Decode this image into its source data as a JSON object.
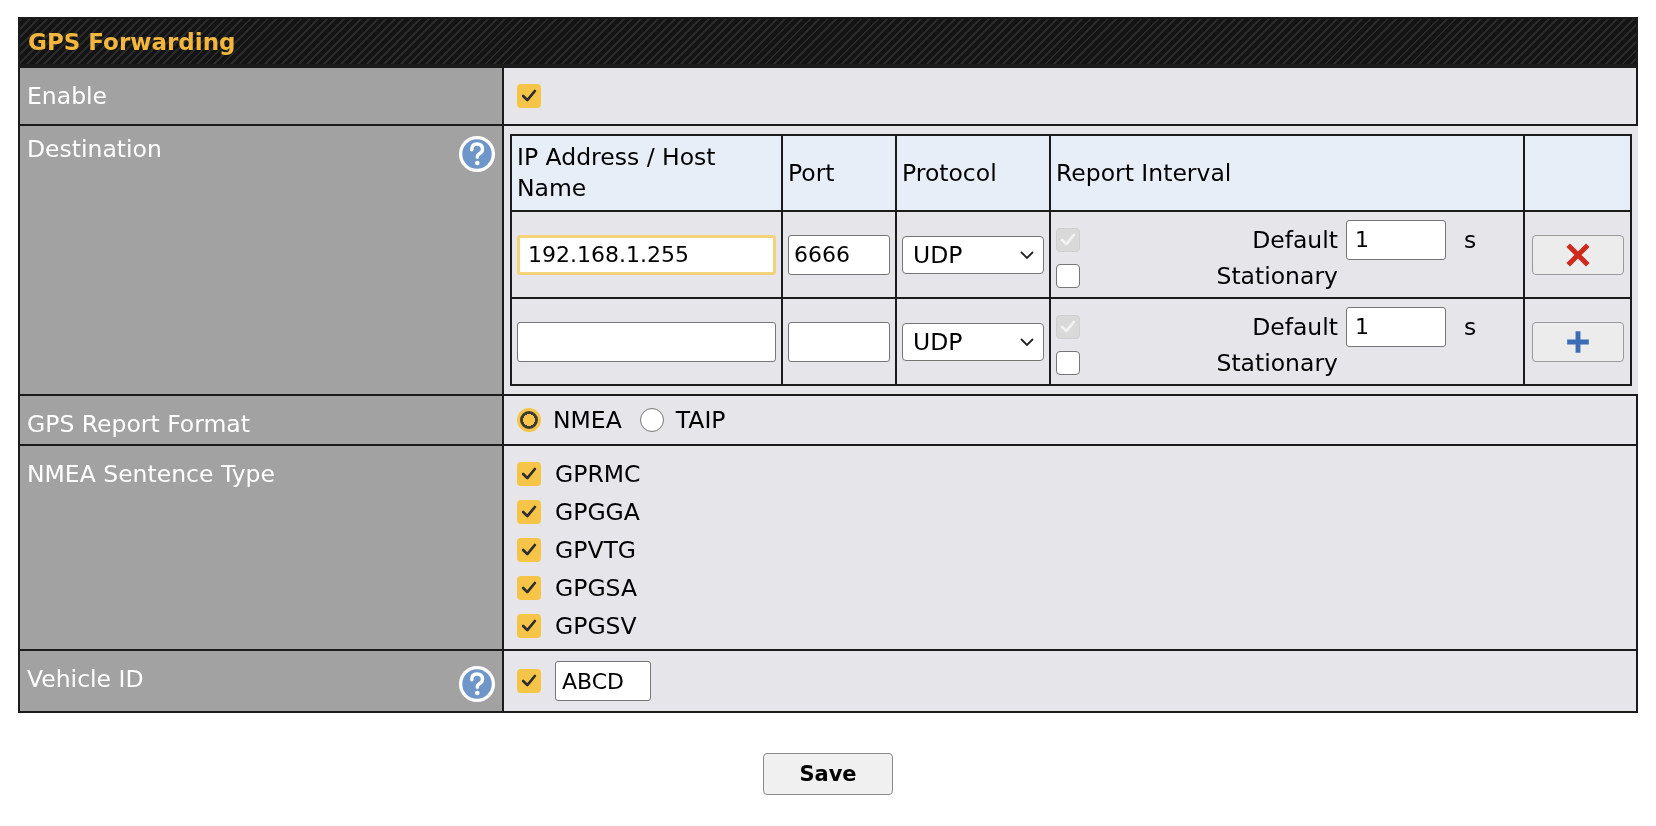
{
  "section": {
    "title": "GPS Forwarding"
  },
  "rows": [
    {
      "kind": "checkbox",
      "label": "Enable",
      "help": false,
      "checked": true
    },
    {
      "kind": "destinations",
      "label": "Destination",
      "help": true,
      "columns": [
        "IP Address / Host Name",
        "Port",
        "Protocol",
        "Report Interval"
      ],
      "entries": [
        {
          "host": "192.168.1.255",
          "host_focused": true,
          "port": "6666",
          "protocol": "UDP",
          "default_checked": true,
          "default_disabled": true,
          "default_label": "Default",
          "interval": "1",
          "unit": "s",
          "stationary_checked": false,
          "stationary_label": "Stationary",
          "kind": "remove"
        },
        {
          "host_focused": false,
          "protocol": "UDP",
          "default_checked": true,
          "default_disabled": true,
          "default_label": "Default",
          "interval": "1",
          "unit": "s",
          "stationary_checked": false,
          "stationary_label": "Stationary",
          "kind": "add"
        }
      ]
    },
    {
      "kind": "radio",
      "label": "GPS Report Format",
      "help": false,
      "options": [
        {
          "label": "NMEA",
          "selected": true
        },
        {
          "label": "TAIP",
          "selected": false
        }
      ]
    },
    {
      "kind": "checklist",
      "label": "NMEA Sentence Type",
      "help": false,
      "items": [
        {
          "label": "GPRMC",
          "checked": true
        },
        {
          "label": "GPGGA",
          "checked": true
        },
        {
          "label": "GPVTG",
          "checked": true
        },
        {
          "label": "GPGSA",
          "checked": true
        },
        {
          "label": "GPGSV",
          "checked": true
        }
      ]
    },
    {
      "kind": "checked_input",
      "label": "Vehicle ID",
      "help": true,
      "checked": true,
      "value": "ABCD"
    }
  ],
  "save_button": {
    "label": "Save"
  }
}
